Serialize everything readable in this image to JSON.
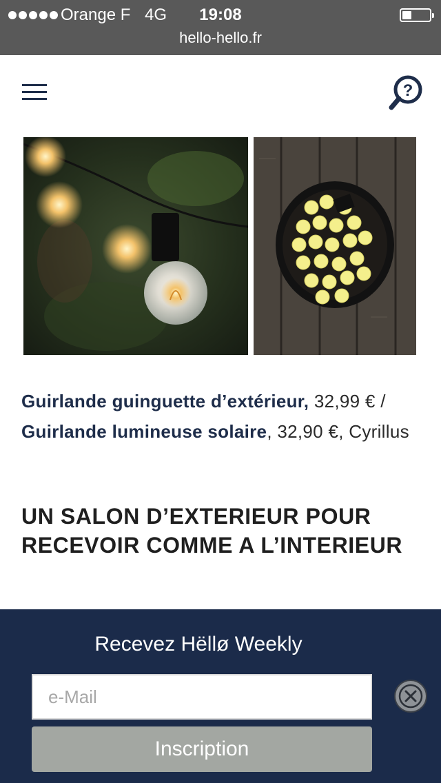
{
  "status_bar": {
    "carrier": "Orange F",
    "network": "4G",
    "time": "19:08",
    "battery_level": 0.35
  },
  "url": "hello-hello.fr",
  "header": {
    "menu_icon": "hamburger-icon",
    "search_icon": "magnifier-question-icon"
  },
  "images": [
    {
      "name": "guinguette-string-lights-photo"
    },
    {
      "name": "solar-lights-bowl-photo"
    }
  ],
  "caption": {
    "product1_name": "Guirlande guinguette d’extérieur,",
    "product1_price": " 32,99 € / ",
    "product2_name": "Guirlande lumineuse solaire",
    "product2_price": ", 32,90 €, Cyrillus"
  },
  "headline": "UN SALON D’EXTERIEUR POUR RECEVOIR COMME A L’INTERIEUR",
  "newsletter": {
    "title": "Recevez Hëllø Weekly",
    "email_placeholder": "e-Mail",
    "email_value": "",
    "submit_label": "Inscription",
    "close_icon": "close-icon"
  },
  "colors": {
    "navy": "#1b2b4a",
    "status_bar": "#595959",
    "button_gray": "#a3a7a2"
  }
}
